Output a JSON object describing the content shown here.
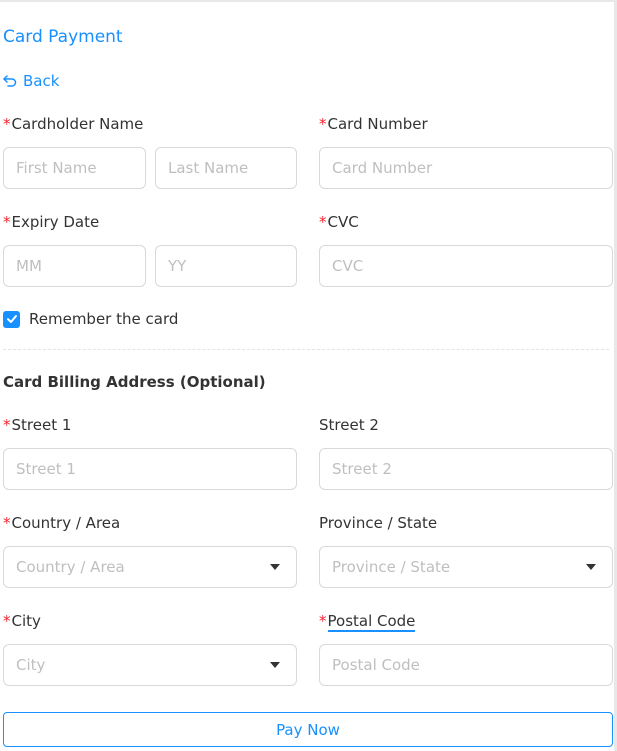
{
  "page": {
    "title": "Card Payment",
    "back_label": "Back"
  },
  "labels": {
    "cardholder_name": "Cardholder Name",
    "card_number": "Card Number",
    "expiry_date": "Expiry Date",
    "cvc": "CVC",
    "street1": "Street 1",
    "street2": "Street 2",
    "country": "Country / Area",
    "province": "Province / State",
    "city": "City",
    "postal_code": "Postal Code"
  },
  "placeholders": {
    "first_name": "First Name",
    "last_name": "Last Name",
    "card_number": "Card Number",
    "month": "MM",
    "year": "YY",
    "cvc": "CVC",
    "street1": "Street 1",
    "street2": "Street 2",
    "country": "Country / Area",
    "province": "Province / State",
    "city": "City",
    "postal_code": "Postal Code"
  },
  "required_mark": "*",
  "remember": {
    "label": "Remember the card",
    "checked": true
  },
  "billing_title": "Card Billing Address (Optional)",
  "pay_button": "Pay Now",
  "colors": {
    "accent": "#1890ff",
    "required": "#f5222d"
  }
}
